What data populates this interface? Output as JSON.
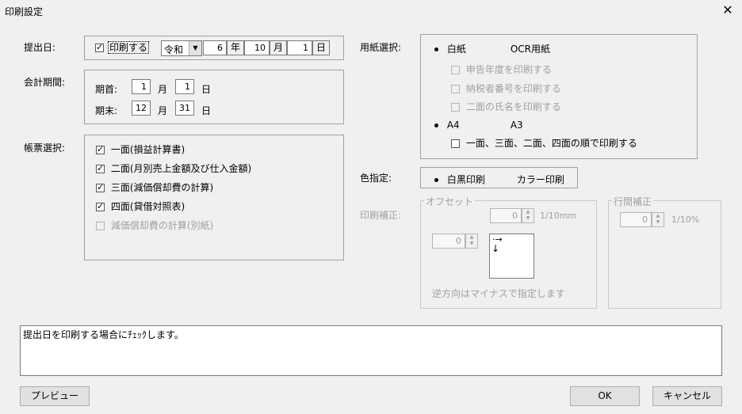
{
  "window": {
    "title": "印刷設定",
    "close_symbol": "✕"
  },
  "submit_date": {
    "label": "提出日:",
    "print_checkbox_label": "印刷する",
    "print_checked": true,
    "era": "令和",
    "year": "6",
    "year_unit": "年",
    "month": "10",
    "month_unit": "月",
    "day": "1",
    "day_unit": "日"
  },
  "period": {
    "label": "会計期間:",
    "start_label": "期首:",
    "start_month": "1",
    "start_month_unit": "月",
    "start_day": "1",
    "start_day_unit": "日",
    "end_label": "期末:",
    "end_month": "12",
    "end_month_unit": "月",
    "end_day": "31",
    "end_day_unit": "日"
  },
  "forms": {
    "label": "帳票選択:",
    "items": [
      {
        "label": "一面(損益計算書)",
        "checked": true,
        "enabled": true
      },
      {
        "label": "二面(月別売上金額及び仕入金額)",
        "checked": true,
        "enabled": true
      },
      {
        "label": "三面(減価償却費の計算)",
        "checked": true,
        "enabled": true
      },
      {
        "label": "四面(貸借対照表)",
        "checked": true,
        "enabled": true
      },
      {
        "label": "減価償却費の計算(別紙)",
        "checked": false,
        "enabled": false
      }
    ]
  },
  "paper": {
    "label": "用紙選択:",
    "options": [
      "白紙",
      "OCR用紙"
    ],
    "selected": "白紙",
    "sub_options": [
      {
        "label": "申告年度を印刷する",
        "enabled": false
      },
      {
        "label": "納税者番号を印刷する",
        "enabled": false
      },
      {
        "label": "二面の氏名を印刷する",
        "enabled": false
      }
    ],
    "size_options": [
      "A4",
      "A3"
    ],
    "size_selected": "A4",
    "order_label": "一面、三面、二面、四面の順で印刷する",
    "order_checked": false
  },
  "color": {
    "label": "色指定:",
    "options": [
      "白黒印刷",
      "カラー印刷"
    ],
    "selected": "白黒印刷"
  },
  "correction": {
    "label": "印刷補正:",
    "offset_legend": "オフセット",
    "offset_y": "0",
    "offset_y_unit": "1/10mm",
    "offset_x": "0",
    "preview_arrow_right": "·→",
    "preview_arrow_down": "↓",
    "note": "逆方向はマイナスで指定します",
    "line_legend": "行間補正",
    "line_value": "0",
    "line_unit": "1/10%"
  },
  "help_text": "提出日を印刷する場合にﾁｪｯｸします。",
  "buttons": {
    "preview": "プレビュー",
    "ok": "OK",
    "cancel": "キャンセル"
  }
}
